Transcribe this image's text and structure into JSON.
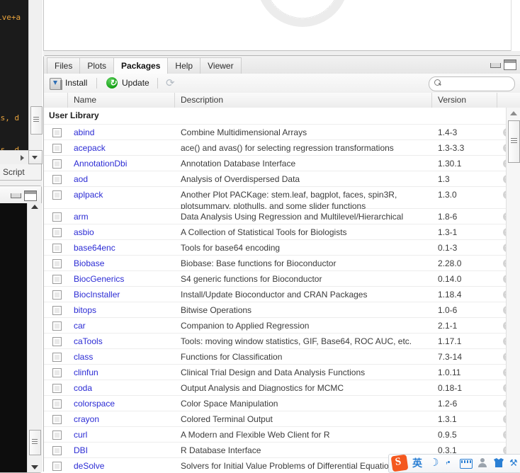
{
  "source_pane": {
    "console_lines": [
      "ive+a",
      "ks, d",
      "ks, d"
    ],
    "doc_type": "R Script"
  },
  "packages_pane": {
    "tabs": [
      {
        "label": "Files",
        "active": false
      },
      {
        "label": "Plots",
        "active": false
      },
      {
        "label": "Packages",
        "active": true
      },
      {
        "label": "Help",
        "active": false
      },
      {
        "label": "Viewer",
        "active": false
      }
    ],
    "toolbar": {
      "install_label": "Install",
      "update_label": "Update",
      "refresh_glyph": "⟳"
    },
    "search": {
      "value": "",
      "placeholder": ""
    },
    "columns": {
      "checkbox": "",
      "name": "Name",
      "description": "Description",
      "version": "Version",
      "remove": ""
    },
    "group_label": "User Library",
    "rows": [
      {
        "name": "abind",
        "description": "Combine Multidimensional Arrays",
        "version": "1.4-3",
        "lines": 1
      },
      {
        "name": "acepack",
        "description": "ace() and avas() for selecting regression transformations",
        "version": "1.3-3.3",
        "lines": 1
      },
      {
        "name": "AnnotationDbi",
        "description": "Annotation Database Interface",
        "version": "1.30.1",
        "lines": 1
      },
      {
        "name": "aod",
        "description": "Analysis of Overdispersed Data",
        "version": "1.3",
        "lines": 1
      },
      {
        "name": "aplpack",
        "description": "Another Plot PACKage: stem.leaf, bagplot, faces, spin3R, plotsummary, plothulls, and some slider functions",
        "version": "1.3.0",
        "lines": 2
      },
      {
        "name": "arm",
        "description": "Data Analysis Using Regression and Multilevel/Hierarchical Models",
        "version": "1.8-6",
        "lines": 1
      },
      {
        "name": "asbio",
        "description": "A Collection of Statistical Tools for Biologists",
        "version": "1.3-1",
        "lines": 1
      },
      {
        "name": "base64enc",
        "description": "Tools for base64 encoding",
        "version": "0.1-3",
        "lines": 1
      },
      {
        "name": "Biobase",
        "description": "Biobase: Base functions for Bioconductor",
        "version": "2.28.0",
        "lines": 1
      },
      {
        "name": "BiocGenerics",
        "description": "S4 generic functions for Bioconductor",
        "version": "0.14.0",
        "lines": 1
      },
      {
        "name": "BiocInstaller",
        "description": "Install/Update Bioconductor and CRAN Packages",
        "version": "1.18.4",
        "lines": 1
      },
      {
        "name": "bitops",
        "description": "Bitwise Operations",
        "version": "1.0-6",
        "lines": 1
      },
      {
        "name": "car",
        "description": "Companion to Applied Regression",
        "version": "2.1-1",
        "lines": 1
      },
      {
        "name": "caTools",
        "description": "Tools: moving window statistics, GIF, Base64, ROC AUC, etc.",
        "version": "1.17.1",
        "lines": 1
      },
      {
        "name": "class",
        "description": "Functions for Classification",
        "version": "7.3-14",
        "lines": 1
      },
      {
        "name": "clinfun",
        "description": "Clinical Trial Design and Data Analysis Functions",
        "version": "1.0.11",
        "lines": 1
      },
      {
        "name": "coda",
        "description": "Output Analysis and Diagnostics for MCMC",
        "version": "0.18-1",
        "lines": 1
      },
      {
        "name": "colorspace",
        "description": "Color Space Manipulation",
        "version": "1.2-6",
        "lines": 1
      },
      {
        "name": "crayon",
        "description": "Colored Terminal Output",
        "version": "1.3.1",
        "lines": 1
      },
      {
        "name": "curl",
        "description": "A Modern and Flexible Web Client for R",
        "version": "0.9.5",
        "lines": 1
      },
      {
        "name": "DBI",
        "description": "R Database Interface",
        "version": "0.3.1",
        "lines": 1
      },
      {
        "name": "deSolve",
        "description": "Solvers for Initial Value Problems of Differential Equations (",
        "version": "",
        "lines": 1
      }
    ]
  },
  "ime_bar": {
    "logo_text": "S",
    "mode_label": "英",
    "moon_glyph": "☽",
    "wrench_glyph": "⚒"
  },
  "colors": {
    "link": "#2b2bd4",
    "update_green": "#15a015",
    "ime_blue": "#2a7fd4",
    "ime_orange": "#f4581f"
  }
}
